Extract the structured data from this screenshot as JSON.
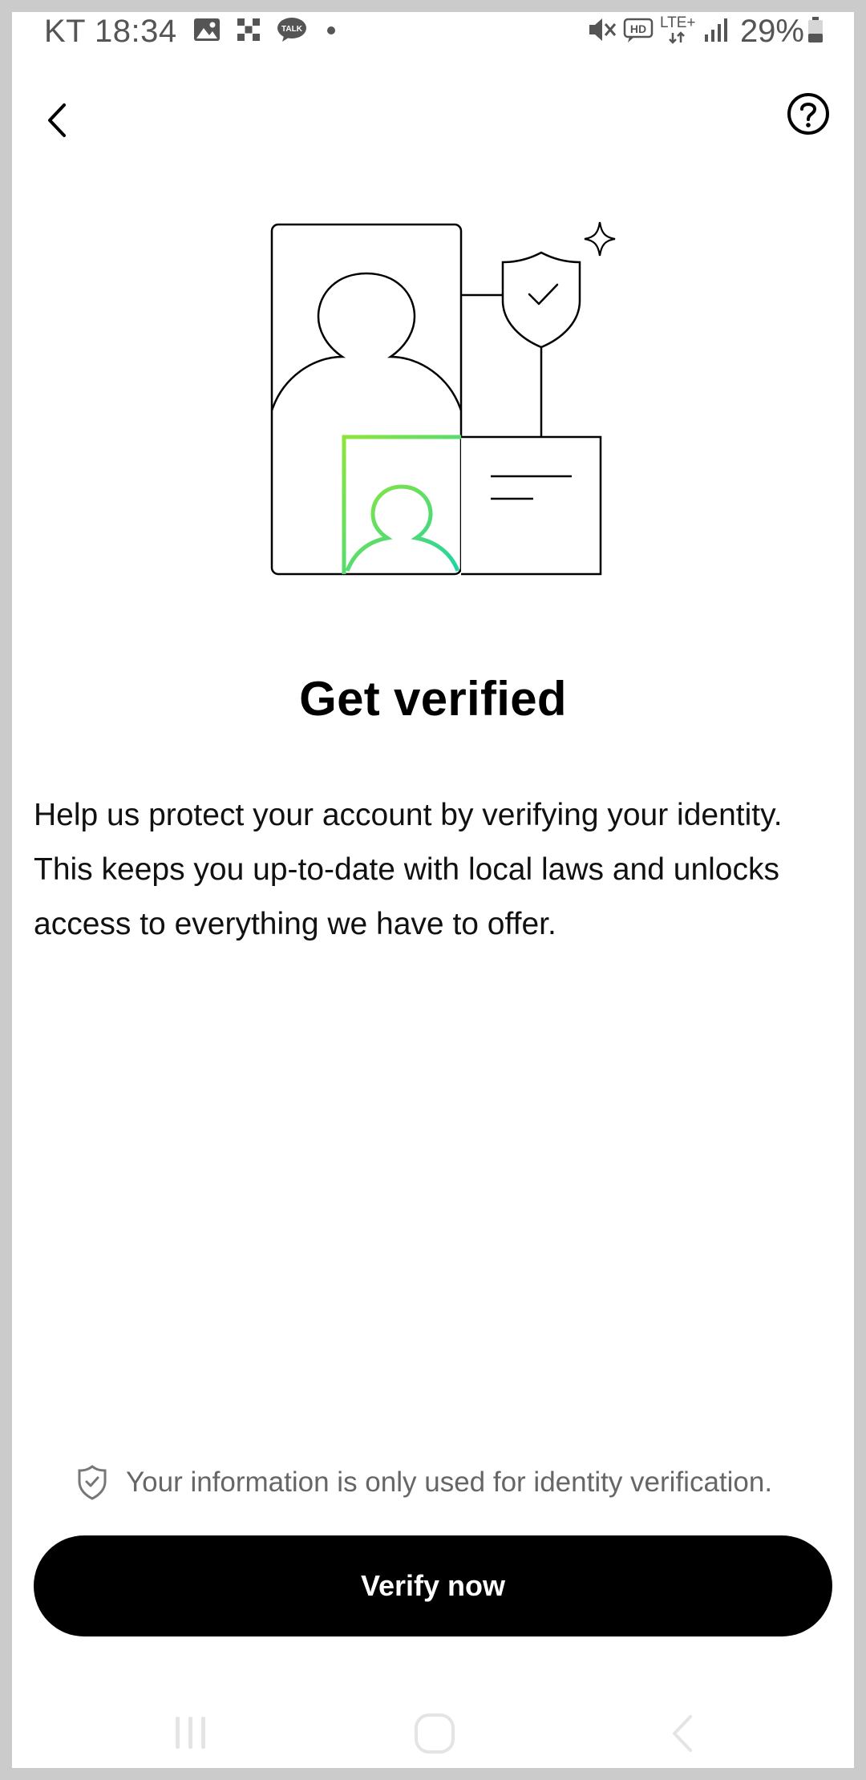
{
  "status_bar": {
    "carrier_time": "KT 18:34",
    "battery": "29%",
    "left_icons": [
      "gallery-icon",
      "grid-app-icon",
      "kakaotalk-icon",
      "dot-icon"
    ],
    "right_icons": [
      "mute-icon",
      "hd-icon",
      "lte-icon",
      "signal-icon",
      "battery-icon"
    ],
    "talk_badge": "TALK",
    "hd_label": "HD",
    "lte_label": "LTE+"
  },
  "header": {
    "back_icon": "chevron-left-icon",
    "help_icon": "question-circle-icon"
  },
  "illustration": {
    "icon": "identity-verification-illustration",
    "accent_start": "#8EE53A",
    "accent_end": "#1FD3A4"
  },
  "main": {
    "title": "Get verified",
    "description": "Help us protect your account by verifying your identity. This keeps you up-to-date with local laws and unlocks access to everything we have to offer."
  },
  "footer": {
    "privacy_icon": "shield-check-icon",
    "privacy_text": "Your information is only used for identity verification.",
    "verify_label": "Verify now"
  },
  "colors": {
    "primary": "#000000",
    "background": "#FFFFFF",
    "muted_text": "#666666"
  },
  "system_nav": [
    "recents-icon",
    "home-icon",
    "system-back-icon"
  ]
}
